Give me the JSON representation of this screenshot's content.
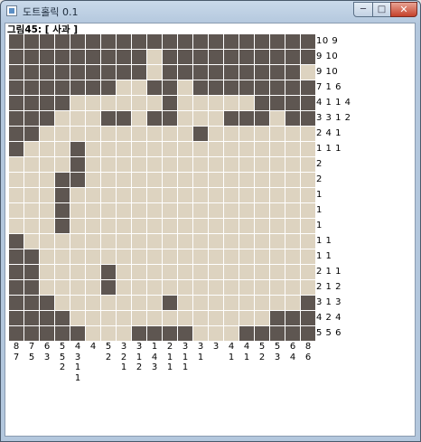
{
  "window": {
    "title": "도트홀릭 0.1",
    "minimize_label": "─",
    "maximize_label": "□",
    "close_label": "✕"
  },
  "puzzle": {
    "label": "그림45: [ 사과 ]",
    "colors": {
      "filled": "#5e5651",
      "empty": "#ddd3c0",
      "grid": "#ffffff"
    },
    "rows": [
      "######################",
      "#########.############",
      "#########.#########",
      "#######..##.##########",
      "####......#.....######",
      "###...##.##...###.####",
      "##..........#.........##",
      "#...#.................#",
      "....#.................",
      "...##.................",
      "...#..................",
      "...#..................",
      "...#..................",
      "#.....................",
      "##...................#",
      "##....#.............##",
      "##....#.............##",
      "###.......#........###",
      "####.............####",
      "#####...####...######"
    ],
    "row_clues": [
      "10 9",
      "9 10",
      "9 10",
      "7 1 6",
      "4 1 1 4",
      "3 3 1 2",
      "2 4 1",
      "1 1 1",
      "2",
      "2",
      "1",
      "1",
      "1",
      "1 1",
      "1 1",
      "2 1 1",
      "2 1 2",
      "3 1 3",
      "4 2 4",
      "5 5 6"
    ],
    "col_clues": [
      [
        "8",
        "7"
      ],
      [
        "7",
        "5"
      ],
      [
        "6",
        "3"
      ],
      [
        "5",
        "5",
        "2"
      ],
      [
        "4",
        "3",
        "1",
        "1"
      ],
      [
        "4"
      ],
      [
        "5",
        "2"
      ],
      [
        "3",
        "2",
        "1"
      ],
      [
        "3",
        "1",
        "2"
      ],
      [
        "1",
        "4",
        "3"
      ],
      [
        "2",
        "1",
        "1"
      ],
      [
        "3",
        "1",
        "1"
      ],
      [
        "3",
        "1"
      ],
      [
        "3"
      ],
      [
        "4",
        "1"
      ],
      [
        "4",
        "1"
      ],
      [
        "5",
        "2"
      ],
      [
        "5",
        "3"
      ],
      [
        "6",
        "4"
      ],
      [
        "8",
        "6"
      ]
    ]
  }
}
